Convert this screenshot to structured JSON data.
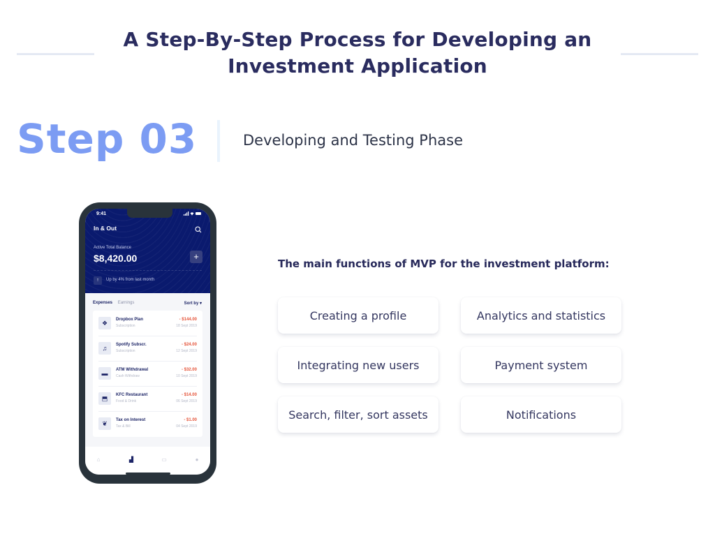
{
  "title": "A Step-By-Step Process for Developing an Investment Application",
  "step": {
    "label": "Step 03",
    "subtitle": "Developing and Testing Phase"
  },
  "phone": {
    "status_time": "9:41",
    "status_icons": "signal-wifi-battery",
    "app_title": "In & Out",
    "balance_label": "Active Total Balance",
    "balance_value": "$8,420.00",
    "plus_label": "+",
    "trend_text": "Up by 4% from last month",
    "tabs": [
      "Expenses",
      "Earnings"
    ],
    "sort_label": "Sort by ▾",
    "transactions": [
      {
        "icon": "dropbox-icon",
        "glyph": "❖",
        "name": "Dropbox Plan",
        "category": "Subscription",
        "amount": "- $144.00",
        "date": "18 Sept 2019"
      },
      {
        "icon": "music-icon",
        "glyph": "♫",
        "name": "Spotify Subscr.",
        "category": "Subscription",
        "amount": "- $24.00",
        "date": "12 Sept 2019"
      },
      {
        "icon": "wallet-icon",
        "glyph": "▬",
        "name": "ATM Withdrawal",
        "category": "Cash Withdraw",
        "amount": "- $32.00",
        "date": "10 Sept 2019"
      },
      {
        "icon": "food-icon",
        "glyph": "⬒",
        "name": "KFC Restaurant",
        "category": "Food & Drink",
        "amount": "- $14.00",
        "date": "06 Sept 2019"
      },
      {
        "icon": "leaf-icon",
        "glyph": "❦",
        "name": "Tax on Interest",
        "category": "Tax & Bill",
        "amount": "- $1.00",
        "date": "04 Sept 2019"
      }
    ],
    "nav": [
      {
        "name": "home-icon",
        "glyph": "⌂"
      },
      {
        "name": "stats-icon",
        "glyph": "▟"
      },
      {
        "name": "card-icon",
        "glyph": "▭"
      },
      {
        "name": "profile-icon",
        "glyph": "●"
      }
    ]
  },
  "mvp": {
    "heading": "The main functions of MVP for the investment platform:",
    "features": [
      "Creating a profile",
      "Analytics and statistics",
      "Integrating new users",
      "Payment system",
      "Search, filter, sort assets",
      "Notifications"
    ]
  }
}
